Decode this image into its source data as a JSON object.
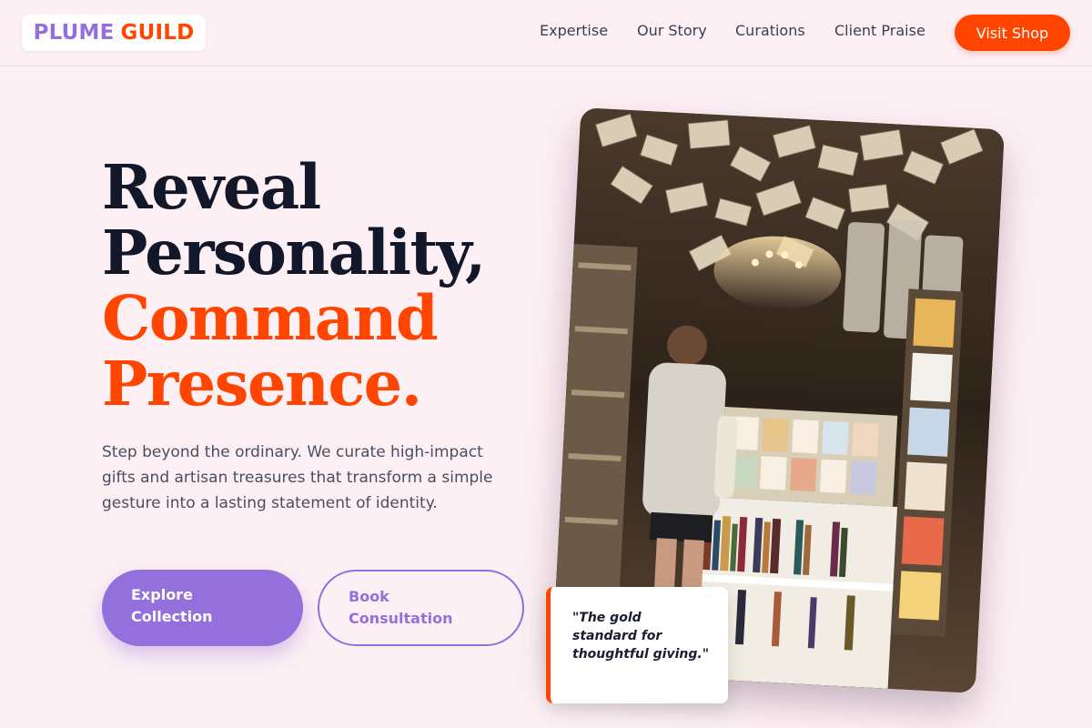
{
  "brand": {
    "part1": "PLUME",
    "part2": "GUILD"
  },
  "nav": {
    "items": [
      "Expertise",
      "Our Story",
      "Curations",
      "Client Praise"
    ],
    "cta": "Visit Shop"
  },
  "hero": {
    "headline_line1": "Reveal",
    "headline_line2": "Personality,",
    "headline_accent1": "Command",
    "headline_accent2": "Presence.",
    "lead": "Step beyond the ordinary. We curate high-impact gifts and artisan treasures that transform a simple gesture into a lasting statement of identity.",
    "primary_cta": "Explore Collection",
    "secondary_cta": "Book Consultation"
  },
  "quote": "\"The gold standard for thoughtful giving.\"",
  "colors": {
    "accent": "#ff4500",
    "brand_purple": "#9370db",
    "background": "#fdf0f4",
    "heading": "#13172a"
  }
}
